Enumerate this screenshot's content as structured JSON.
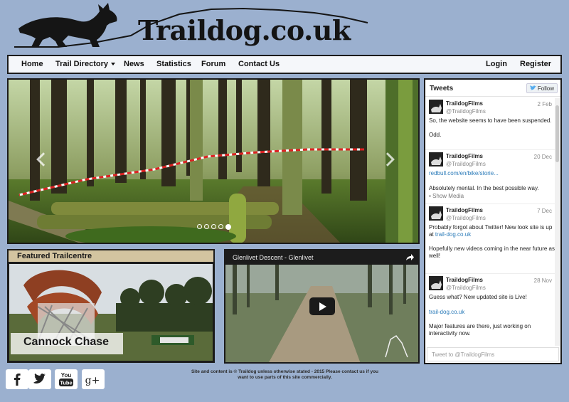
{
  "brand": {
    "logo_text": "Traildog.co.uk"
  },
  "nav": {
    "home": "Home",
    "trail_directory": "Trail Directory",
    "news": "News",
    "statistics": "Statistics",
    "forum": "Forum",
    "contact": "Contact Us",
    "login": "Login",
    "register": "Register"
  },
  "carousel": {
    "slide_count": 5,
    "active_index": 4
  },
  "featured": {
    "header": "Featured Trailcentre",
    "name": "Cannock Chase"
  },
  "video": {
    "title": "Glenlivet Descent - Glenlivet",
    "icons": [
      "share-icon",
      "play-icon"
    ]
  },
  "tweets": {
    "title": "Tweets",
    "follow_label": "Follow",
    "compose_placeholder": "Tweet to @TraildogFilms",
    "items": [
      {
        "author": "TraildogFilms",
        "handle": "@TraildogFilms",
        "date": "2 Feb",
        "lines": [
          "So, the website seems to have been suspended.",
          "Odd."
        ]
      },
      {
        "author": "TraildogFilms",
        "handle": "@TraildogFilms",
        "date": "20 Dec",
        "link": "redbull.com/en/bike/storie...",
        "lines": [
          "Absolutely mental. In the best possible way."
        ],
        "media": "Show Media"
      },
      {
        "author": "TraildogFilms",
        "handle": "@TraildogFilms",
        "date": "7 Dec",
        "lines": [
          "Probably forgot about Twitter! New look site is up",
          "at",
          "Hopefully new videos coming in the near future as",
          "well!"
        ],
        "link": "trail-dog.co.uk"
      },
      {
        "author": "TraildogFilms",
        "handle": "@TraildogFilms",
        "date": "28 Nov",
        "lines": [
          "Guess what? New updated site is Live!",
          "Major features are there, just working on",
          "interactivity now."
        ],
        "link": "trail-dog.co.uk"
      }
    ]
  },
  "footer": {
    "text": "Site and content is © Traildog unless otherwise stated - 2015 Please contact us if you want to use parts of this site commercially.",
    "social": [
      "facebook-icon",
      "twitter-icon",
      "youtube-icon",
      "google-plus-icon"
    ]
  },
  "colors": {
    "page_bg": "#9bb0cf",
    "navbar_bg": "#f5f7fa",
    "featured_header_bg": "#d3c4a0",
    "link": "#2b7bb9"
  }
}
